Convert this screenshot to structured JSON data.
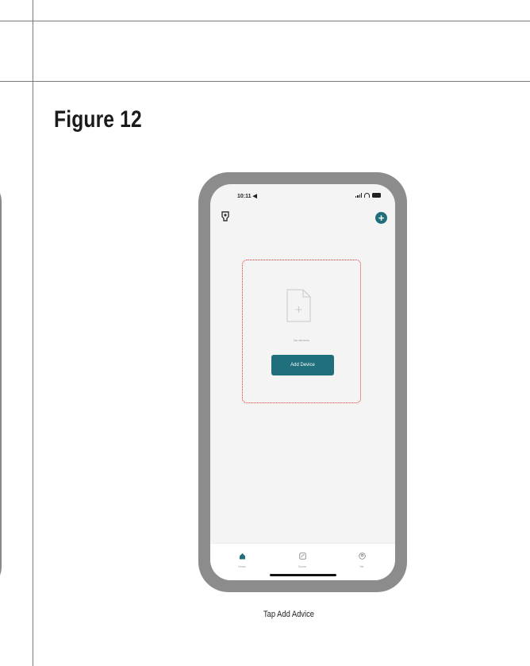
{
  "figure": {
    "title": "Figure 12",
    "caption": "Tap Add Advice"
  },
  "phone": {
    "status_time": "10:11 ◀",
    "empty_text": "No devices",
    "add_device_label": "Add Device",
    "tabs": [
      {
        "label": "Home",
        "icon": "home-icon",
        "active": true
      },
      {
        "label": "Scene",
        "icon": "scene-icon",
        "active": false
      },
      {
        "label": "Me",
        "icon": "profile-icon",
        "active": false
      }
    ]
  },
  "colors": {
    "accent": "#1f6f7c",
    "frame": "#8c8c8c",
    "highlight": "#e0342a"
  }
}
